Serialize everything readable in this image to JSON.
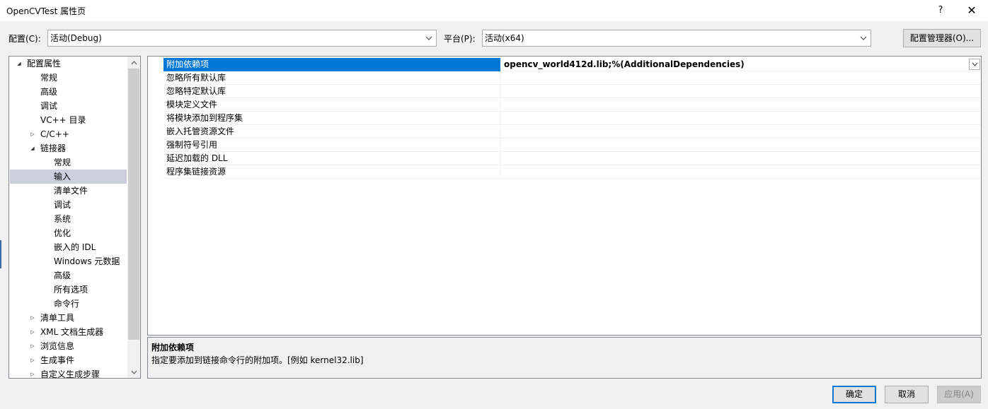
{
  "window": {
    "title": "OpenCVTest 属性页",
    "help_glyph": "?",
    "close_glyph": "✕"
  },
  "toolbar": {
    "config_label": "配置(C):",
    "config_value": "活动(Debug)",
    "platform_label": "平台(P):",
    "platform_value": "活动(x64)",
    "config_manager_label": "配置管理器(O)..."
  },
  "tree": {
    "items": [
      {
        "label": "配置属性",
        "expander": "◢"
      },
      {
        "label": "常规",
        "expander": ""
      },
      {
        "label": "高级",
        "expander": ""
      },
      {
        "label": "调试",
        "expander": ""
      },
      {
        "label": "VC++ 目录",
        "expander": ""
      },
      {
        "label": "C/C++",
        "expander": "▷"
      },
      {
        "label": "链接器",
        "expander": "◢"
      },
      {
        "label": "常规",
        "expander": ""
      },
      {
        "label": "输入",
        "expander": ""
      },
      {
        "label": "清单文件",
        "expander": ""
      },
      {
        "label": "调试",
        "expander": ""
      },
      {
        "label": "系统",
        "expander": ""
      },
      {
        "label": "优化",
        "expander": ""
      },
      {
        "label": "嵌入的 IDL",
        "expander": ""
      },
      {
        "label": "Windows 元数据",
        "expander": ""
      },
      {
        "label": "高级",
        "expander": ""
      },
      {
        "label": "所有选项",
        "expander": ""
      },
      {
        "label": "命令行",
        "expander": ""
      },
      {
        "label": "清单工具",
        "expander": "▷"
      },
      {
        "label": "XML 文档生成器",
        "expander": "▷"
      },
      {
        "label": "浏览信息",
        "expander": "▷"
      },
      {
        "label": "生成事件",
        "expander": "▷"
      },
      {
        "label": "自定义生成步骤",
        "expander": "▷"
      }
    ]
  },
  "grid": {
    "rows": [
      {
        "name": "附加依赖项",
        "value": "opencv_world412d.lib;%(AdditionalDependencies)"
      },
      {
        "name": "忽略所有默认库",
        "value": ""
      },
      {
        "name": "忽略特定默认库",
        "value": ""
      },
      {
        "name": "模块定义文件",
        "value": ""
      },
      {
        "name": "将模块添加到程序集",
        "value": ""
      },
      {
        "name": "嵌入托管资源文件",
        "value": ""
      },
      {
        "name": "强制符号引用",
        "value": ""
      },
      {
        "name": "延迟加载的 DLL",
        "value": ""
      },
      {
        "name": "程序集链接资源",
        "value": ""
      }
    ]
  },
  "description": {
    "title": "附加依赖项",
    "text": "指定要添加到链接命令行的附加项。[例如 kernel32.lib]"
  },
  "buttons": {
    "ok": "确定",
    "cancel": "取消",
    "apply": "应用(A)"
  }
}
